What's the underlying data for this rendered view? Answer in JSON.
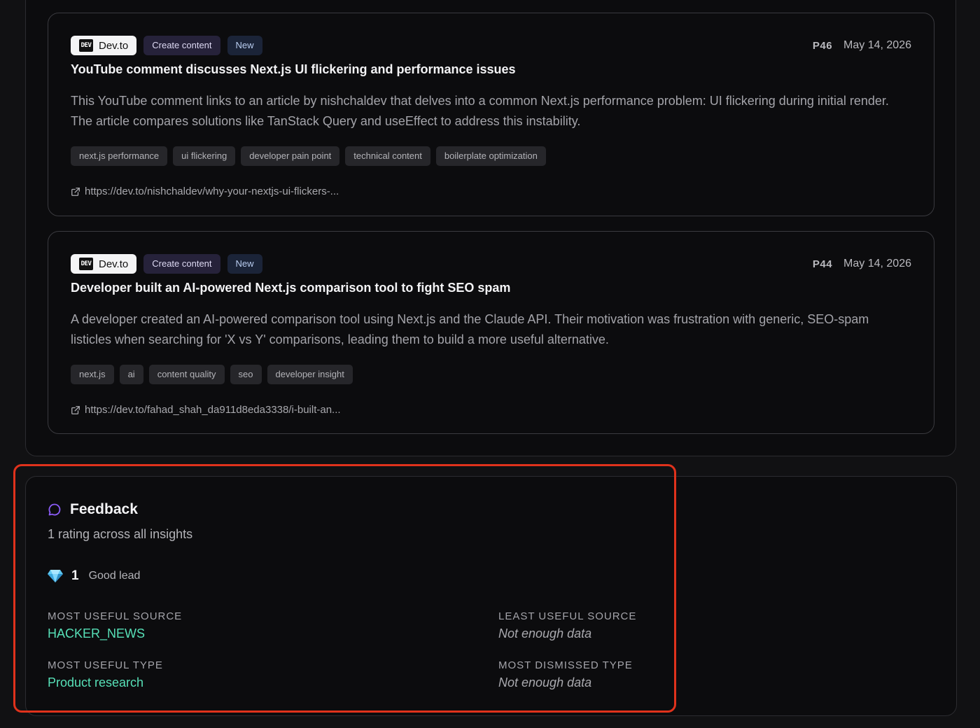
{
  "insights": [
    {
      "source": "Dev.to",
      "source_logo": "DEV",
      "type": "Create content",
      "status": "New",
      "priority": "P46",
      "date": "May 14, 2026",
      "title": "YouTube comment discusses Next.js UI flickering and performance issues",
      "description": "This YouTube comment links to an article by nishchaldev that delves into a common Next.js performance problem: UI flickering during initial render. The article compares solutions like TanStack Query and useEffect to address this instability.",
      "tags": [
        "next.js performance",
        "ui flickering",
        "developer pain point",
        "technical content",
        "boilerplate optimization"
      ],
      "url": "https://dev.to/nishchaldev/why-your-nextjs-ui-flickers-..."
    },
    {
      "source": "Dev.to",
      "source_logo": "DEV",
      "type": "Create content",
      "status": "New",
      "priority": "P44",
      "date": "May 14, 2026",
      "title": "Developer built an AI-powered Next.js comparison tool to fight SEO spam",
      "description": "A developer created an AI-powered comparison tool using Next.js and the Claude API. Their motivation was frustration with generic, SEO-spam listicles when searching for 'X vs Y' comparisons, leading them to build a more useful alternative.",
      "tags": [
        "next.js",
        "ai",
        "content quality",
        "seo",
        "developer insight"
      ],
      "url": "https://dev.to/fahad_shah_da911d8eda3338/i-built-an..."
    }
  ],
  "feedback": {
    "title": "Feedback",
    "subtitle": "1 rating across all insights",
    "good_lead_count": "1",
    "good_lead_label": "Good lead",
    "most_useful_source_label": "MOST USEFUL SOURCE",
    "most_useful_source_value": "HACKER_NEWS",
    "least_useful_source_label": "LEAST USEFUL SOURCE",
    "least_useful_source_value": "Not enough data",
    "most_useful_type_label": "MOST USEFUL TYPE",
    "most_useful_type_value": "Product research",
    "most_dismissed_type_label": "MOST DISMISSED TYPE",
    "most_dismissed_type_value": "Not enough data"
  },
  "colors": {
    "accent_good": "#57e0b7",
    "feedback_icon": "#8b5cf6",
    "highlight": "#e0321c"
  }
}
